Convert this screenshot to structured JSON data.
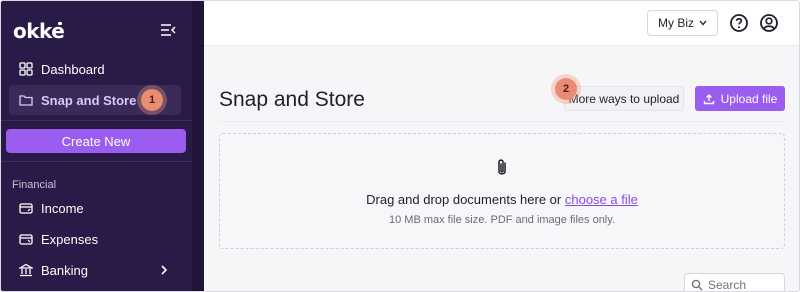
{
  "app": {
    "logo_text": "okke"
  },
  "sidebar": {
    "items": [
      {
        "label": "Dashboard",
        "icon": "grid-icon"
      },
      {
        "label": "Snap and Store",
        "icon": "folder-icon",
        "active": true
      }
    ],
    "step_badge_1": "1",
    "create_label": "Create New",
    "section_financial": "Financial",
    "financial_items": [
      {
        "label": "Income",
        "icon": "income-card-icon"
      },
      {
        "label": "Expenses",
        "icon": "expense-card-icon"
      },
      {
        "label": "Banking",
        "icon": "bank-icon"
      }
    ]
  },
  "topbar": {
    "business_select": "My Biz",
    "help_icon": "help-circle-icon",
    "account_icon": "user-circle-icon"
  },
  "main": {
    "title": "Snap and Store",
    "step_badge_2": "2",
    "more_ways_label": "More ways to upload",
    "upload_label": "Upload file",
    "dropzone": {
      "text_prefix": "Drag and drop documents here or ",
      "link_text": "choose a file",
      "hint": "10 MB max file size. PDF and image files only."
    },
    "search_placeholder": "Search"
  },
  "colors": {
    "sidebar_bg": "#2a1a47",
    "accent": "#9b5cf0",
    "badge": "#e88c73",
    "active_text": "#d9c8ff"
  }
}
